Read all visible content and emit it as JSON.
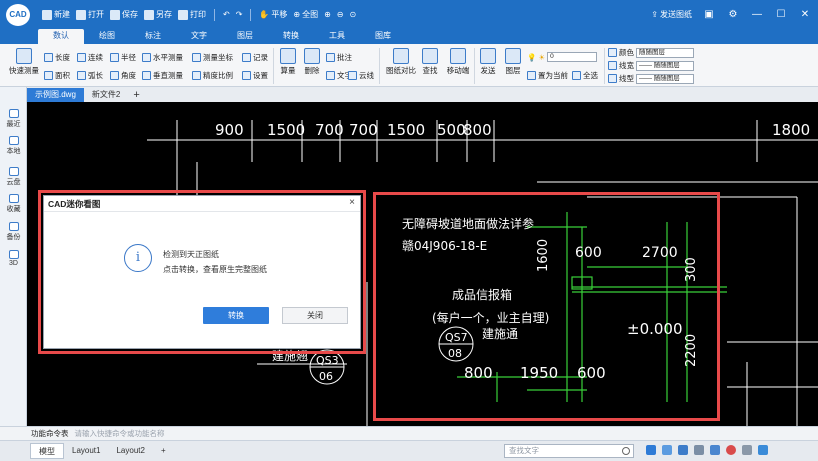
{
  "titlebar": {
    "logo": "CAD",
    "quick_access": [
      "新建",
      "打开",
      "保存",
      "另存",
      "打印",
      "平移",
      "全图"
    ],
    "send_drawing": "发送图纸"
  },
  "ribbon_tabs": [
    "数认",
    "绘图",
    "标注",
    "文字",
    "图层",
    "转换",
    "工具",
    "图库"
  ],
  "ribbon": {
    "quick_measure": "快速测量",
    "length": "长度",
    "continuous": "连续",
    "radius": "半径",
    "horizontal_measure": "水平测量",
    "measure_coord": "测量坐标",
    "record": "记录",
    "area": "面积",
    "arc_length": "弧长",
    "angle": "角度",
    "vertical_measure": "垂直测量",
    "precision_scale": "精度比例",
    "settings": "设置",
    "calc": "算量",
    "delete": "删除",
    "annotate": "批注",
    "text": "文字",
    "cloud_line": "云线",
    "compare": "图纸对比",
    "find": "查找",
    "move_drawing": "移动端",
    "send": "发送",
    "layer": "图层",
    "set_current": "置为当前",
    "select_all": "全选",
    "layer_value": "0",
    "color_label": "颜色",
    "color_value": "随随图层",
    "linewidth_label": "线宽",
    "linewidth_value": "—— 随随图层",
    "linetype_label": "线型",
    "linetype_value": "—— 随随图层"
  },
  "doc_tabs": [
    "示例图.dwg",
    "新文件2"
  ],
  "sidebar": [
    "最近",
    "本地",
    "云盘",
    "收藏",
    "备份",
    "3D"
  ],
  "drawing": {
    "top_dims": [
      "900",
      "1500",
      "700",
      "700",
      "1500",
      "500",
      "800",
      "1800"
    ],
    "title1": "无障碍坡道地面做法详参",
    "title2": "赣04J906-18-E",
    "right_dims": [
      "600",
      "2700",
      "1600",
      "300",
      "2200"
    ],
    "qs7": "QS7",
    "qs7_num": "08",
    "qs3": "QS3",
    "qs3_num": "06",
    "box_label": "成品信报箱",
    "box_note": "(每户一个，业主自理)",
    "construct": "建施通",
    "construct2": "建施翘",
    "elev": "±0.000",
    "bottom_dims": [
      "800",
      "1950",
      "600"
    ]
  },
  "dialog": {
    "title": "CAD迷你看图",
    "line1": "检测到天正图纸",
    "line2": "点击转换，查看原生完整图纸",
    "ok": "转换",
    "cancel": "关闭",
    "close_glyph": "×",
    "info_glyph": "i"
  },
  "command": {
    "label": "功能命令表",
    "placeholder": "请输入快捷命令或功能名称"
  },
  "status": {
    "tabs": [
      "模型",
      "Layout1",
      "Layout2"
    ],
    "add": "+",
    "find_placeholder": "查找文字"
  },
  "colors": {
    "accent": "#1f6fc4",
    "highlight": "#e84a4a",
    "cad_green": "#39d039",
    "cad_white": "#ffffff"
  }
}
